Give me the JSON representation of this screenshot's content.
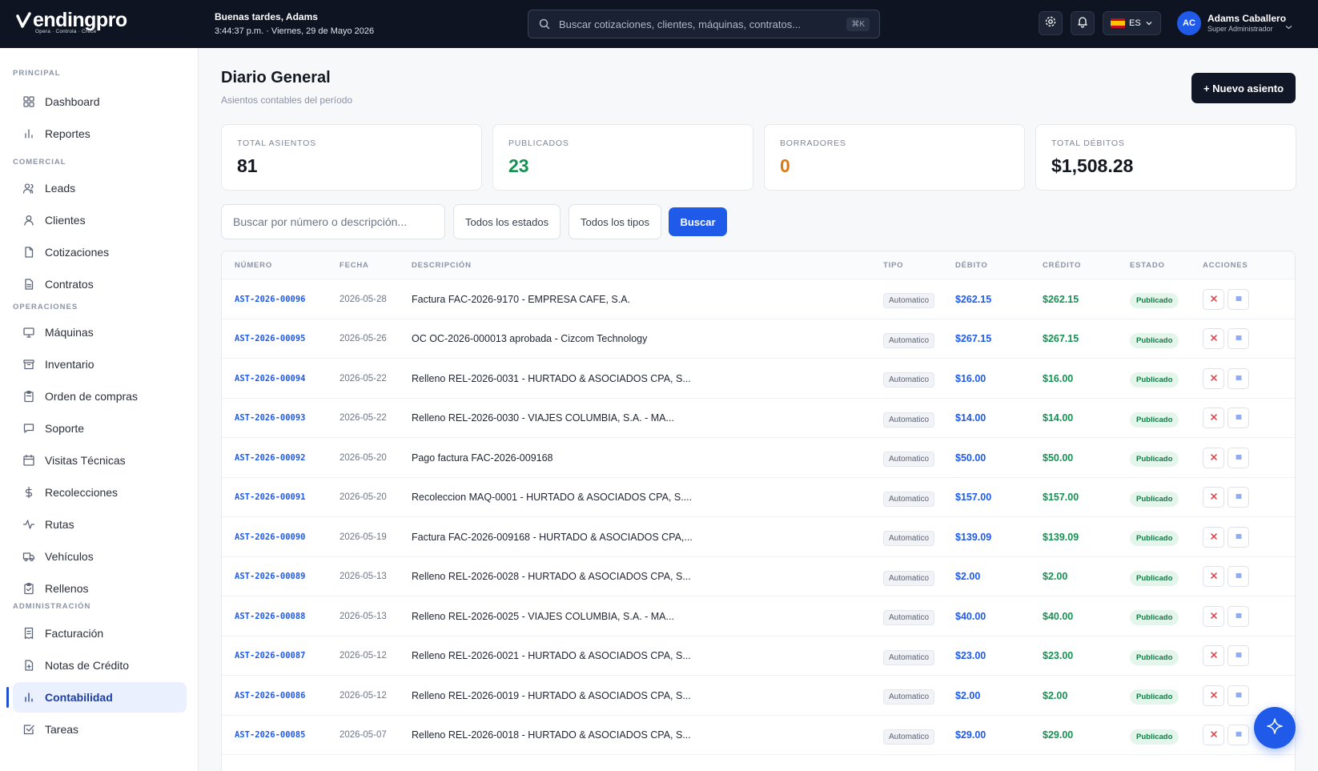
{
  "brand": {
    "name": "endingpro",
    "tagline": "Opera · Controla · Crece"
  },
  "header": {
    "greeting": "Buenas tardes, Adams",
    "datetime": "3:44:37 p.m. · Viernes, 29 de Mayo 2026",
    "search_placeholder": "Buscar cotizaciones, clientes, máquinas, contratos...",
    "search_shortcut": "⌘K",
    "language": "ES",
    "user_initials": "AC",
    "user_name": "Adams Caballero",
    "user_role": "Super Administrador"
  },
  "sidebar": {
    "sections": [
      {
        "title": "PRINCIPAL",
        "items": [
          {
            "label": "Dashboard",
            "icon": "grid-icon"
          },
          {
            "label": "Reportes",
            "icon": "bar-chart-icon"
          }
        ]
      },
      {
        "title": "COMERCIAL",
        "items": [
          {
            "label": "Leads",
            "icon": "users-icon"
          },
          {
            "label": "Clientes",
            "icon": "user-icon"
          },
          {
            "label": "Cotizaciones",
            "icon": "file-icon"
          },
          {
            "label": "Contratos",
            "icon": "file-text-icon"
          }
        ]
      },
      {
        "title": "OPERACIONES",
        "items": [
          {
            "label": "Máquinas",
            "icon": "monitor-icon"
          },
          {
            "label": "Inventario",
            "icon": "archive-icon"
          },
          {
            "label": "Orden de compras",
            "icon": "clipboard-icon"
          },
          {
            "label": "Soporte",
            "icon": "message-icon"
          },
          {
            "label": "Visitas Técnicas",
            "icon": "calendar-icon"
          },
          {
            "label": "Recolecciones",
            "icon": "dollar-icon"
          },
          {
            "label": "Rutas",
            "icon": "activity-icon"
          },
          {
            "label": "Vehículos",
            "icon": "truck-icon"
          },
          {
            "label": "Rellenos",
            "icon": "clipboard-check-icon"
          }
        ]
      },
      {
        "title": "ADMINISTRACIÓN",
        "items": [
          {
            "label": "Facturación",
            "icon": "receipt-icon"
          },
          {
            "label": "Notas de Crédito",
            "icon": "file-plus-icon"
          },
          {
            "label": "Contabilidad",
            "icon": "bar-chart-icon",
            "active": true
          },
          {
            "label": "Tareas",
            "icon": "check-square-icon"
          }
        ]
      }
    ]
  },
  "page": {
    "title": "Diario General",
    "subtitle": "Asientos contables del período",
    "new_button": "+ Nuevo asiento"
  },
  "stats": [
    {
      "label": "TOTAL ASIENTOS",
      "value": "81",
      "color": "#141821"
    },
    {
      "label": "PUBLICADOS",
      "value": "23",
      "color": "#149153"
    },
    {
      "label": "BORRADORES",
      "value": "0",
      "color": "#d97a12"
    },
    {
      "label": "TOTAL DÉBITOS",
      "value": "$1,508.28",
      "color": "#141821"
    }
  ],
  "filters": {
    "search_placeholder": "Buscar por número o descripción...",
    "status_select": "Todos los estados",
    "type_select": "Todos los tipos",
    "search_button": "Buscar"
  },
  "table": {
    "columns": [
      "NÚMERO",
      "FECHA",
      "DESCRIPCIÓN",
      "TIPO",
      "DÉBITO",
      "CRÉDITO",
      "ESTADO",
      "ACCIONES"
    ],
    "rows": [
      {
        "num": "AST-2026-00096",
        "date": "2026-05-28",
        "desc": "Factura FAC-2026-9170 - EMPRESA CAFE, S.A.",
        "type": "Automatico",
        "debit": "$262.15",
        "credit": "$262.15",
        "status": "Publicado"
      },
      {
        "num": "AST-2026-00095",
        "date": "2026-05-26",
        "desc": "OC OC-2026-000013 aprobada - Cizcom Technology",
        "type": "Automatico",
        "debit": "$267.15",
        "credit": "$267.15",
        "status": "Publicado"
      },
      {
        "num": "AST-2026-00094",
        "date": "2026-05-22",
        "desc": "Relleno REL-2026-0031 - HURTADO & ASOCIADOS CPA, S...",
        "type": "Automatico",
        "debit": "$16.00",
        "credit": "$16.00",
        "status": "Publicado"
      },
      {
        "num": "AST-2026-00093",
        "date": "2026-05-22",
        "desc": "Relleno REL-2026-0030 - VIAJES COLUMBIA, S.A. - MA...",
        "type": "Automatico",
        "debit": "$14.00",
        "credit": "$14.00",
        "status": "Publicado"
      },
      {
        "num": "AST-2026-00092",
        "date": "2026-05-20",
        "desc": "Pago factura FAC-2026-009168",
        "type": "Automatico",
        "debit": "$50.00",
        "credit": "$50.00",
        "status": "Publicado"
      },
      {
        "num": "AST-2026-00091",
        "date": "2026-05-20",
        "desc": "Recoleccion MAQ-0001 - HURTADO & ASOCIADOS CPA, S....",
        "type": "Automatico",
        "debit": "$157.00",
        "credit": "$157.00",
        "status": "Publicado"
      },
      {
        "num": "AST-2026-00090",
        "date": "2026-05-19",
        "desc": "Factura FAC-2026-009168 - HURTADO & ASOCIADOS CPA,...",
        "type": "Automatico",
        "debit": "$139.09",
        "credit": "$139.09",
        "status": "Publicado"
      },
      {
        "num": "AST-2026-00089",
        "date": "2026-05-13",
        "desc": "Relleno REL-2026-0028 - HURTADO & ASOCIADOS CPA, S...",
        "type": "Automatico",
        "debit": "$2.00",
        "credit": "$2.00",
        "status": "Publicado"
      },
      {
        "num": "AST-2026-00088",
        "date": "2026-05-13",
        "desc": "Relleno REL-2026-0025 - VIAJES COLUMBIA, S.A. - MA...",
        "type": "Automatico",
        "debit": "$40.00",
        "credit": "$40.00",
        "status": "Publicado"
      },
      {
        "num": "AST-2026-00087",
        "date": "2026-05-12",
        "desc": "Relleno REL-2026-0021 - HURTADO & ASOCIADOS CPA, S...",
        "type": "Automatico",
        "debit": "$23.00",
        "credit": "$23.00",
        "status": "Publicado"
      },
      {
        "num": "AST-2026-00086",
        "date": "2026-05-12",
        "desc": "Relleno REL-2026-0019 - HURTADO & ASOCIADOS CPA, S...",
        "type": "Automatico",
        "debit": "$2.00",
        "credit": "$2.00",
        "status": "Publicado"
      },
      {
        "num": "AST-2026-00085",
        "date": "2026-05-07",
        "desc": "Relleno REL-2026-0018 - HURTADO & ASOCIADOS CPA, S...",
        "type": "Automatico",
        "debit": "$29.00",
        "credit": "$29.00",
        "status": "Publicado"
      }
    ]
  }
}
